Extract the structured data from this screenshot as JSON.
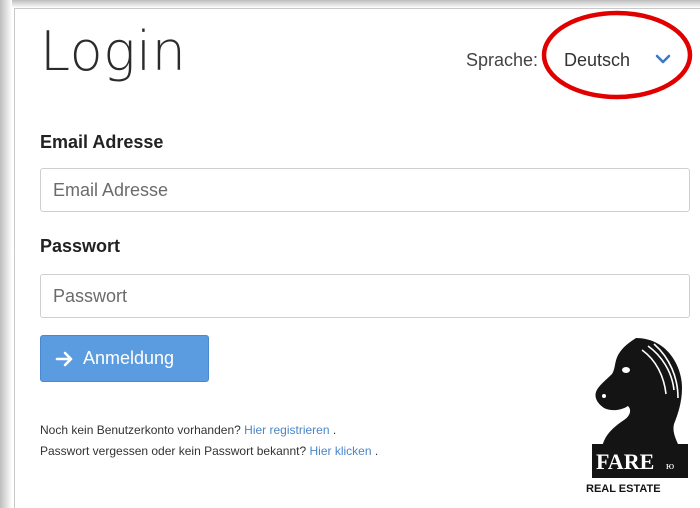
{
  "header": {
    "title": "Login",
    "language_label": "Sprache:",
    "language_selected": "Deutsch"
  },
  "form": {
    "email_label": "Email Adresse",
    "email_placeholder": "Email Adresse",
    "email_value": "",
    "password_label": "Passwort",
    "password_placeholder": "Passwort",
    "password_value": "",
    "submit_label": "Anmeldung"
  },
  "footer": {
    "register_text": "Noch kein Benutzerkonto vorhanden?",
    "register_link": "Hier registrieren",
    "register_suffix": ".",
    "forgot_text": "Passwort vergessen oder kein Passwort bekannt?",
    "forgot_link": "Hier klicken",
    "forgot_suffix": "."
  },
  "logo": {
    "name": "FARE",
    "name_suffix": "ю",
    "subtitle": "REAL ESTATE"
  },
  "colors": {
    "accent": "#5b9be0",
    "link": "#4a86c8",
    "highlight": "#e00000"
  },
  "icons": {
    "submit": "arrow-right-icon",
    "select": "chevron-down-icon",
    "logo": "knight-horse-icon"
  }
}
